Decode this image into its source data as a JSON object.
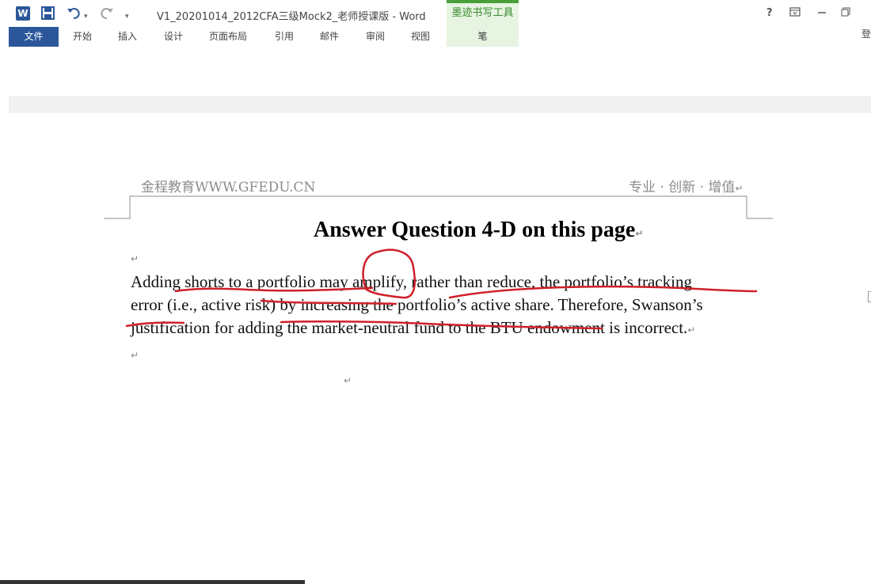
{
  "titlebar": {
    "app_icon": "W",
    "document_title": "V1_20201014_2012CFA三级Mock2_老师授课版 - Word",
    "tool_tab_label": "墨迹书写工具",
    "icons": {
      "save": "floppy-icon",
      "undo": "undo-icon",
      "redo": "redo-icon",
      "customize": "dropdown-icon",
      "help": "?",
      "ribbon_display": "ribbon-display-icon",
      "minimize": "minimize-icon",
      "restore": "restore-icon"
    }
  },
  "tabs": [
    {
      "label": "文件"
    },
    {
      "label": "开始"
    },
    {
      "label": "插入"
    },
    {
      "label": "设计"
    },
    {
      "label": "页面布局"
    },
    {
      "label": "引用"
    },
    {
      "label": "邮件"
    },
    {
      "label": "审阅"
    },
    {
      "label": "视图"
    },
    {
      "label": "笔"
    }
  ],
  "login": "登",
  "document": {
    "header_left": "金程教育WWW.GFEDU.CN",
    "header_right": "专业 · 创新 · 增值",
    "heading": "Answer Question 4-D on this page",
    "paragraph_lines": [
      "Adding shorts to a portfolio may amplify, rather than reduce, the portfolio’s tracking",
      "error (i.e., active risk) by increasing the portfolio’s active share. Therefore, Swanson’s",
      "justification for adding the market-neutral fund to the BTU endowment is incorrect."
    ],
    "paragraph_mark": "↵"
  },
  "colors": {
    "word_blue": "#2b579a",
    "ink_tool_green": "#4a9e3a",
    "pen_ink": "#d0202a"
  }
}
